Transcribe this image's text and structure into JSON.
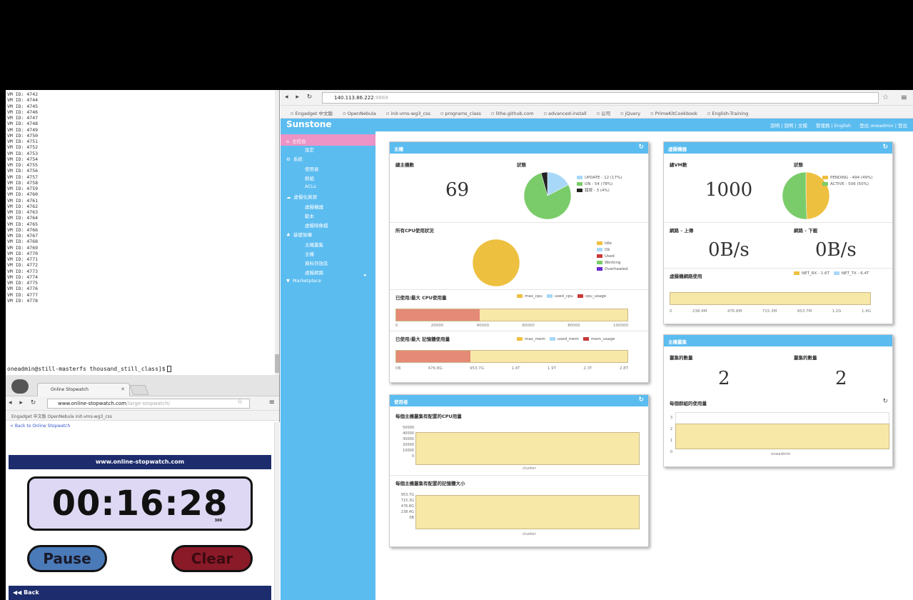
{
  "terminal": {
    "lines": [
      "VM ID: 4742",
      "VM ID: 4744",
      "VM ID: 4745",
      "VM ID: 4746",
      "VM ID: 4747",
      "VM ID: 4748",
      "VM ID: 4749",
      "VM ID: 4750",
      "VM ID: 4751",
      "VM ID: 4752",
      "VM ID: 4753",
      "VM ID: 4754",
      "VM ID: 4755",
      "VM ID: 4756",
      "VM ID: 4757",
      "VM ID: 4758",
      "VM ID: 4759",
      "VM ID: 4760",
      "VM ID: 4761",
      "VM ID: 4762",
      "VM ID: 4763",
      "VM ID: 4764",
      "VM ID: 4765",
      "VM ID: 4766",
      "VM ID: 4767",
      "VM ID: 4768",
      "VM ID: 4769",
      "VM ID: 4770",
      "VM ID: 4771",
      "VM ID: 4772",
      "VM ID: 4773",
      "VM ID: 4774",
      "VM ID: 4775",
      "VM ID: 4776",
      "VM ID: 4777",
      "VM ID: 4778"
    ],
    "prompt": "oneadmin@still-masterfs thousand_still_class]$"
  },
  "stopwatch_browser": {
    "tab_title": "Online Stopwatch",
    "url_main": "www.online-stopwatch.com",
    "url_rest": "/large-stopwatch/",
    "bookmarks": "Engadget 中文版   OpenNebula   init-vms-wg3_css",
    "back_link": "< Back to Online Stopwatch",
    "site_header": "www.online-stopwatch.com",
    "time": "00:16:28",
    "ms": "300",
    "pause_label": "Pause",
    "clear_label": "Clear",
    "back_label": "◀◀ Back"
  },
  "main_browser": {
    "url_main": "140.113.86.222",
    "url_rest": ":9869",
    "bookmarks": [
      "Engadget 中文版",
      "OpenNebula",
      "init-vms-wg3_css",
      "programs_class",
      "lithe.github.com",
      "advanced-install",
      "公司",
      "jQuery",
      "PrimeKitCookbook",
      "English-Training"
    ]
  },
  "app": {
    "logo": "Sunstone",
    "user_links": [
      "說明 | 說明 | 文檔",
      "管理員 | English",
      "登出 oneadmin | 登出"
    ],
    "sidebar": [
      {
        "label": "主控台",
        "icon": "⌂",
        "active": true
      },
      {
        "label": "設定",
        "sub": true
      },
      {
        "label": "系統",
        "icon": "⚙"
      },
      {
        "label": "使用者",
        "sub": true
      },
      {
        "label": "群組",
        "sub": true
      },
      {
        "label": "ACLs",
        "sub": true
      },
      {
        "label": "虛擬化資源",
        "icon": "☁"
      },
      {
        "label": "虛擬機器",
        "sub": true
      },
      {
        "label": "範本",
        "sub": true
      },
      {
        "label": "虛擬映像檔",
        "sub": true
      },
      {
        "label": "基礎架構",
        "icon": "♣"
      },
      {
        "label": "主機叢集",
        "sub": true
      },
      {
        "label": "主機",
        "sub": true
      },
      {
        "label": "資料存放區",
        "sub": true
      },
      {
        "label": "虛擬網路",
        "sub": true
      },
      {
        "label": "Marketplace",
        "icon": "▼"
      }
    ],
    "sidebar_toggle": "◂"
  },
  "hosts_panel": {
    "title": "主機",
    "total_label": "總主機數",
    "total_value": "69",
    "state_label": "狀態",
    "legend": [
      "UPDATE - 12 (17%)",
      "ON - 54 (78%)",
      "錯誤 - 3 (4%)"
    ],
    "cpu_label": "所有CPU使用狀況",
    "cpu_legend": [
      "Idle",
      "Ok",
      "Used",
      "Working",
      "Overheated"
    ],
    "alloc_cpu_label": "已使用/最大 CPU使用量",
    "alloc_cpu_legend": [
      "max_cpu",
      "used_cpu",
      "cpu_usage"
    ],
    "cpu_axis": [
      "0",
      "20000",
      "40000",
      "60000",
      "80000",
      "100000"
    ],
    "alloc_mem_label": "已使用/最大 記憶體使用量",
    "alloc_mem_legend": [
      "max_mem",
      "used_mem",
      "mem_usage"
    ],
    "mem_axis": [
      "0B",
      "476.8G",
      "953.7G",
      "1.4T",
      "1.9T",
      "2.3T",
      "2.8T"
    ]
  },
  "vms_panel": {
    "title": "虛擬機器",
    "total_label": "總VM數",
    "total_value": "1000",
    "state_label": "狀態",
    "legend": [
      "PENDING - 494 (49%)",
      "ACTIVE - 506 (50%)"
    ],
    "net_up_label": "網路 - 上傳",
    "net_up_value": "0B/s",
    "net_down_label": "網路 - 下載",
    "net_down_value": "0B/s",
    "net_usage_label": "虛擬機網路使用",
    "net_legend": [
      "NET_RX - 1.6T",
      "NET_TX - 6.4T"
    ],
    "net_axis": [
      "0",
      "238.4M",
      "476.8M",
      "715.3M",
      "953.7M",
      "1.2G",
      "1.4G"
    ]
  },
  "users_panel": {
    "title": "使用者",
    "chart1_label": "每個主機叢集有配置的CPU用量",
    "chart1_y": [
      "50000",
      "40000",
      "30000",
      "20000",
      "10000",
      "0"
    ],
    "chart1_x": "cluster",
    "chart2_label": "每個主機叢集有配置的記憶體大小",
    "chart2_y": [
      "953.7G",
      "715.3G",
      "476.8G",
      "238.4G",
      "0B"
    ],
    "chart2_x": "cluster"
  },
  "clusters_panel": {
    "title": "主機叢集",
    "left_label": "叢集的數量",
    "left_value": "2",
    "right_label": "叢集的數量",
    "right_value": "2",
    "per_label": "每個群組的使用量",
    "per_y": [
      "3",
      "2",
      "1",
      "0"
    ],
    "per_x": "oneadmin"
  },
  "chart_data": [
    {
      "type": "pie",
      "title": "狀態",
      "categories": [
        "UPDATE",
        "ON",
        "錯誤"
      ],
      "values": [
        12,
        54,
        3
      ],
      "colors": [
        "#a8d8f8",
        "#7acc6a",
        "#222222"
      ]
    },
    {
      "type": "pie",
      "title": "所有CPU使用狀況",
      "categories": [
        "Idle",
        "Ok",
        "Used",
        "Working",
        "Overheated"
      ],
      "values": [
        100,
        0,
        0,
        0,
        0
      ],
      "colors": [
        "#eec040",
        "#a8d8f8",
        "#c83838",
        "#7acc6a",
        "#6a2ad0"
      ]
    },
    {
      "type": "bar",
      "title": "已使用/最大 CPU使用量",
      "categories": [
        "max_cpu",
        "used_cpu"
      ],
      "values": [
        100000,
        36000
      ],
      "xlim": [
        0,
        100000
      ]
    },
    {
      "type": "bar",
      "title": "已使用/最大 記憶體使用量",
      "categories": [
        "max_mem",
        "used_mem"
      ],
      "values": [
        1.0,
        0.32
      ]
    },
    {
      "type": "pie",
      "title": "狀態",
      "categories": [
        "PENDING",
        "ACTIVE"
      ],
      "values": [
        494,
        506
      ],
      "colors": [
        "#eec040",
        "#7acc6a"
      ]
    }
  ]
}
